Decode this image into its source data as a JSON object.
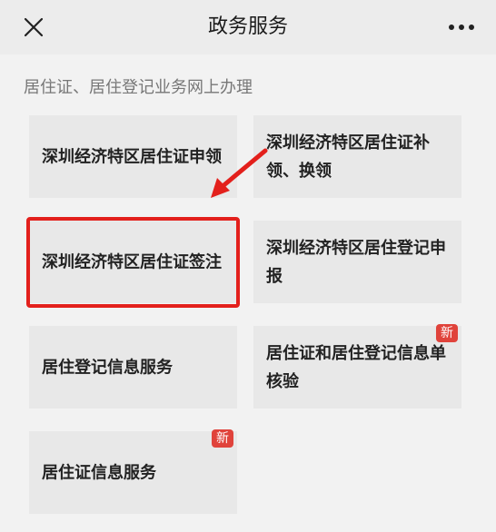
{
  "header": {
    "title": "政务服务",
    "close_icon": "close-icon",
    "more_icon": "more-icon"
  },
  "section": {
    "title": "居住证、居住登记业务网上办理"
  },
  "cards": [
    {
      "label": "深圳经济特区居住证申领",
      "badge": ""
    },
    {
      "label": "深圳经济特区居住证补领、换领",
      "badge": ""
    },
    {
      "label": "深圳经济特区居住证签注",
      "badge": ""
    },
    {
      "label": "深圳经济特区居住登记申报",
      "badge": ""
    },
    {
      "label": "居住登记信息服务",
      "badge": ""
    },
    {
      "label": "居住证和居住登记信息单核验",
      "badge": "新"
    },
    {
      "label": "居住证信息服务",
      "badge": "新"
    }
  ],
  "colors": {
    "highlight": "#e3201c",
    "badge": "#e0433b"
  }
}
